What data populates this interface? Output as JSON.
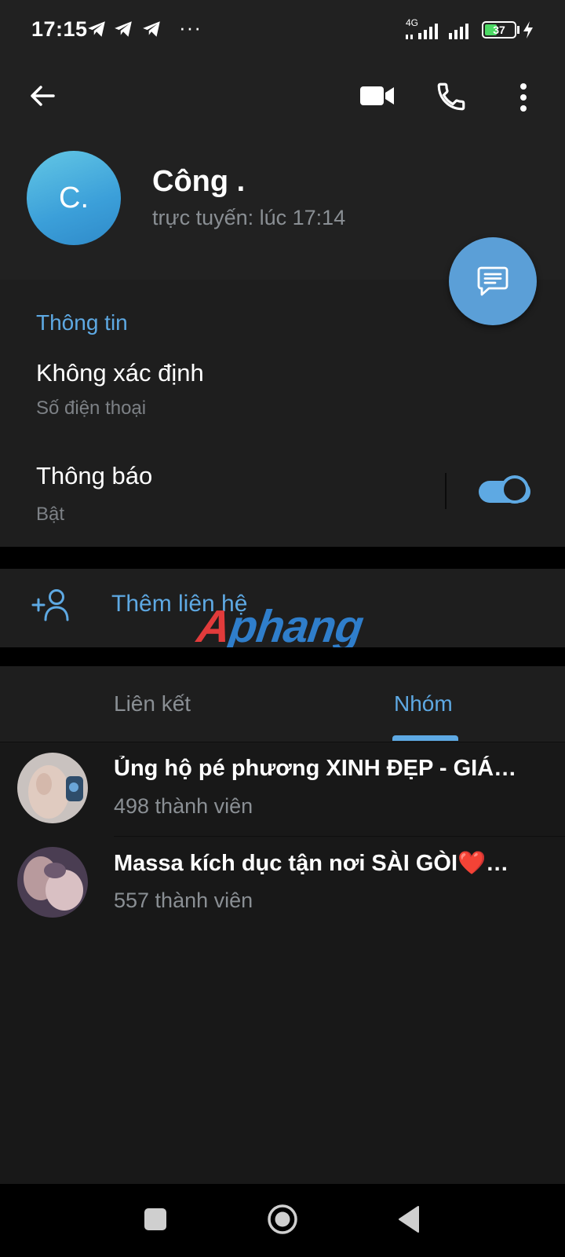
{
  "status_bar": {
    "time": "17:15",
    "overflow_indicator": "···",
    "network_type": "4G",
    "battery_level": "37",
    "icons": [
      "telegram-notification-icon",
      "telegram-notification-icon",
      "telegram-notification-icon",
      "signal-icon",
      "signal-icon",
      "battery-icon",
      "charging-icon"
    ]
  },
  "toolbar": {
    "icons": [
      "back-arrow-icon",
      "video-call-icon",
      "phone-call-icon",
      "more-vert-icon"
    ]
  },
  "profile": {
    "avatar_text": "C.",
    "name": "Công .",
    "status": "trực tuyến: lúc 17:14",
    "fab_icon": "message-icon"
  },
  "info": {
    "section_title": "Thông tin",
    "phone_value": "Không xác định",
    "phone_label": "Số điện thoại",
    "notifications_title": "Thông báo",
    "notifications_value": "Bật",
    "notifications_enabled": true
  },
  "add_contact": {
    "icon": "add-person-icon",
    "label": "Thêm liên hệ"
  },
  "watermark": {
    "text_red": "A",
    "text_blue": "phang"
  },
  "tabs": {
    "items": [
      {
        "label": "Liên kết",
        "active": false
      },
      {
        "label": "Nhóm",
        "active": true
      }
    ]
  },
  "groups": [
    {
      "title": "Ủng hộ pé phương XINH ĐẸP - GIÁ…",
      "members": "498 thành viên"
    },
    {
      "title": "Massa kích dục tận nơi SÀI GÒI❤️…",
      "members": "557 thành viên"
    }
  ],
  "nav_bar": {
    "icons": [
      "recents-square-icon",
      "home-circle-icon",
      "back-triangle-icon"
    ]
  },
  "colors": {
    "accent": "#5ea9e3",
    "background": "#181818",
    "header_bg": "#212121",
    "section_bg": "#1e1e1e",
    "secondary_text": "#8a8f94"
  }
}
